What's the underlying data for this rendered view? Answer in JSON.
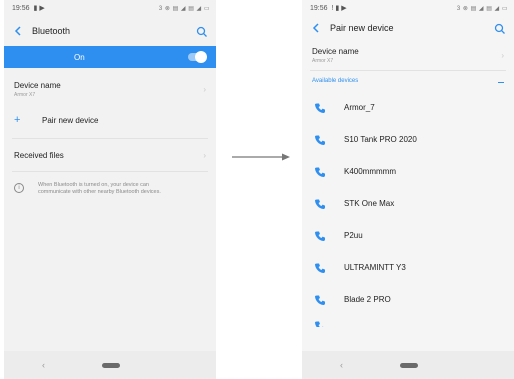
{
  "status_bar": {
    "time": "19:56",
    "icons": "3 ⊗ ▤ ◢ ▤ ◢ ▭"
  },
  "left": {
    "title": "Bluetooth",
    "toggle": {
      "label": "On",
      "state": "on"
    },
    "device_name": {
      "title": "Device name",
      "value": "Armor X7"
    },
    "pair_new": "Pair new device",
    "received_files": "Received files",
    "info": "When Bluetooth is turned on, your device can communicate with other nearby Bluetooth devices."
  },
  "right": {
    "title": "Pair new device",
    "device_name": {
      "title": "Device name",
      "value": "Armor X7"
    },
    "available_label": "Available devices",
    "devices": [
      "Armor_7",
      "S10 Tank PRO 2020",
      "K400mmmmm",
      "STK One Max",
      "P2uu",
      "ULTRAMINTT Y3",
      "Blade 2 PRO"
    ]
  },
  "colors": {
    "accent": "#2f8ff0",
    "text": "#222222",
    "muted": "#999999"
  },
  "icons": [
    "back-arrow-icon",
    "search-icon",
    "plus-icon",
    "info-icon",
    "chevron-right-icon",
    "phone-icon",
    "arrow-right-icon"
  ]
}
